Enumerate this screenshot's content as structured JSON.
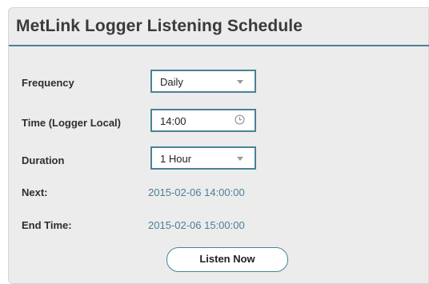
{
  "panel": {
    "title": "MetLink Logger Listening Schedule"
  },
  "form": {
    "frequency": {
      "label": "Frequency",
      "value": "Daily"
    },
    "time": {
      "label": "Time (Logger Local)",
      "value": "14:00"
    },
    "duration": {
      "label": "Duration",
      "value": "1 Hour"
    },
    "next": {
      "label": "Next:",
      "value": "2015-02-06 14:00:00"
    },
    "end_time": {
      "label": "End Time:",
      "value": "2015-02-06 15:00:00"
    }
  },
  "actions": {
    "listen_now_label": "Listen Now"
  },
  "icons": {
    "frequency_dropdown": "chevron-down-icon",
    "time_picker": "clock-icon",
    "duration_dropdown": "chevron-down-icon"
  },
  "colors": {
    "accent": "#4a8296",
    "value_text": "#4a7f96",
    "panel_bg": "#ececec"
  }
}
